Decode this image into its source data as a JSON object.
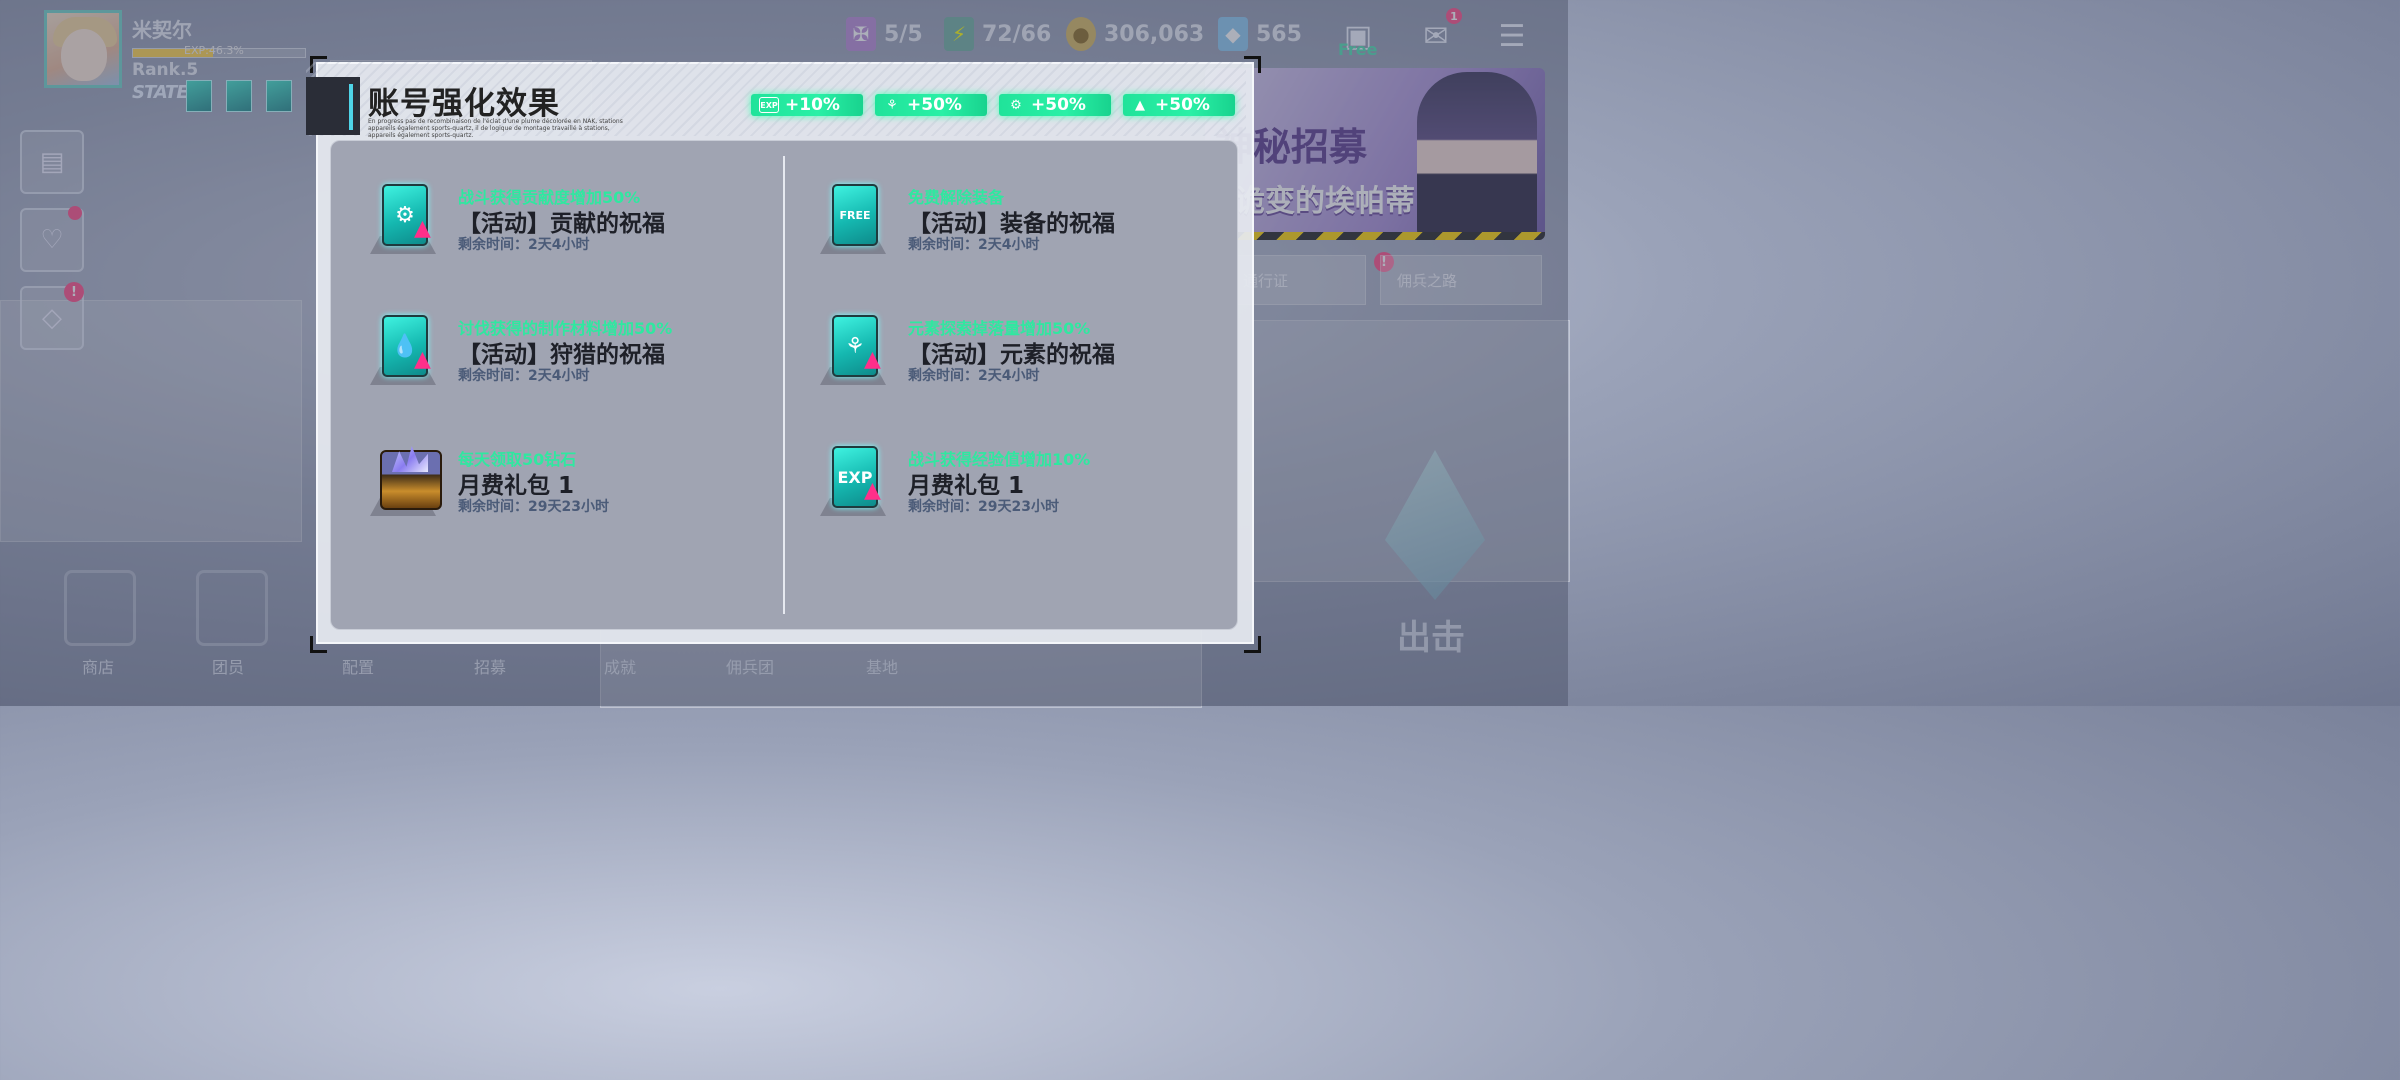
{
  "player": {
    "name": "米契尔",
    "exp_text": "EXP:46.3%",
    "exp_fraction": 0.463,
    "rank": "Rank.5",
    "state_label": "STATE"
  },
  "resources": [
    {
      "icon": "medal-badge-icon",
      "value": "5/5"
    },
    {
      "icon": "energy-battery-icon",
      "value": "72/66"
    },
    {
      "icon": "gold-coin-icon",
      "value": "306,063"
    },
    {
      "icon": "diamond-crystal-icon",
      "value": "565"
    }
  ],
  "top_buttons": {
    "bag_free_label": "Free",
    "mail_badge": "1"
  },
  "side_badges": {
    "phone_badge": "",
    "third_badge": "!"
  },
  "banner": {
    "title": "神秘招募",
    "subtitle": "诡变的埃帕蒂"
  },
  "right_tabs": {
    "pass": "通行证",
    "pass_badge": "!",
    "road": "佣兵之路"
  },
  "bottom_nav": [
    "商店",
    "团员",
    "配置",
    "招募",
    "成就",
    "佣兵团",
    "基地"
  ],
  "sortie_label": "出击",
  "dialog": {
    "title": "账号强化效果",
    "subtitle": "En progress pas de recombinaison de l'éclat d'une plume décolorée en NAK, stations appareils également sports-quartz, il de logique de montage travaillé à stations, appareils également sports-quartz.",
    "bonuses": [
      {
        "icon": "EXP",
        "value": "+10%"
      },
      {
        "icon": "⚘",
        "value": "+50%"
      },
      {
        "icon": "⚙",
        "value": "+50%"
      },
      {
        "icon": "▲",
        "value": "+50%"
      }
    ],
    "buffs": [
      {
        "icon": "gear-card-icon",
        "glyph": "⚙",
        "desc": "战斗获得贡献度增加50%",
        "name": "【活动】贡献的祝福",
        "time": "剩余时间：2天4小时"
      },
      {
        "icon": "hanger-free-card-icon",
        "glyph": "FREE",
        "desc": "免费解除装备",
        "name": "【活动】装备的祝福",
        "time": "剩余时间：2天4小时"
      },
      {
        "icon": "droplet-card-icon",
        "glyph": "💧",
        "desc": "讨伐获得的制作材料增加50%",
        "name": "【活动】狩猎的祝福",
        "time": "剩余时间：2天4小时"
      },
      {
        "icon": "molecule-card-icon",
        "glyph": "⚘",
        "desc": "元素探索掉落量增加50%",
        "name": "【活动】元素的祝福",
        "time": "剩余时间：2天4小时"
      },
      {
        "icon": "treasure-chest-icon",
        "glyph": "",
        "desc": "每天领取50钻石",
        "name": "月费礼包 1",
        "time": "剩余时间：29天23小时"
      },
      {
        "icon": "exp-card-icon",
        "glyph": "EXP",
        "desc": "战斗获得经验值增加10%",
        "name": "月费礼包 1",
        "time": "剩余时间：29天23小时"
      }
    ]
  }
}
